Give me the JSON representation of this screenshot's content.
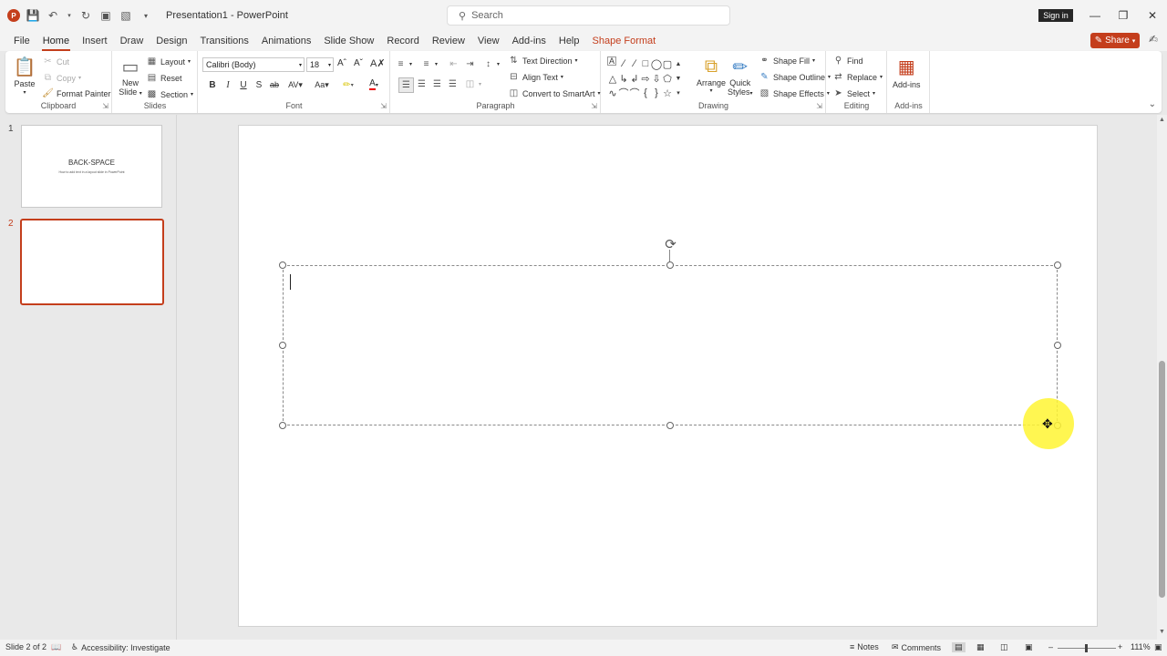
{
  "app": {
    "doc_title": "Presentation1",
    "app_name": "PowerPoint",
    "title_sep": " - ",
    "search_placeholder": "Search",
    "sign_in": "Sign in",
    "share": "Share"
  },
  "tabs": [
    {
      "label": "File"
    },
    {
      "label": "Home",
      "active": true
    },
    {
      "label": "Insert"
    },
    {
      "label": "Draw"
    },
    {
      "label": "Design"
    },
    {
      "label": "Transitions"
    },
    {
      "label": "Animations"
    },
    {
      "label": "Slide Show"
    },
    {
      "label": "Record"
    },
    {
      "label": "Review"
    },
    {
      "label": "View"
    },
    {
      "label": "Add-ins"
    },
    {
      "label": "Help"
    },
    {
      "label": "Shape Format",
      "contextual": true
    }
  ],
  "ribbon": {
    "clipboard": {
      "label": "Clipboard",
      "paste": "Paste",
      "cut": "Cut",
      "copy": "Copy",
      "format_painter": "Format Painter"
    },
    "slides": {
      "label": "Slides",
      "new_slide_1": "New",
      "new_slide_2": "Slide",
      "layout": "Layout",
      "reset": "Reset",
      "section": "Section"
    },
    "font": {
      "label": "Font",
      "font_name": "Calibri (Body)",
      "font_size": "18"
    },
    "paragraph": {
      "label": "Paragraph",
      "text_direction": "Text Direction",
      "align_text": "Align Text",
      "convert_smartart": "Convert to SmartArt"
    },
    "drawing": {
      "label": "Drawing",
      "arrange": "Arrange",
      "quick_styles_1": "Quick",
      "quick_styles_2": "Styles",
      "shape_fill": "Shape Fill",
      "shape_outline": "Shape Outline",
      "shape_effects": "Shape Effects"
    },
    "editing": {
      "label": "Editing",
      "find": "Find",
      "replace": "Replace",
      "select": "Select"
    },
    "addins": {
      "label": "Add-ins",
      "addins": "Add-ins"
    }
  },
  "thumbnails": [
    {
      "num": "1",
      "title": "BACK-SPACE",
      "subtitle": "How to add text in a layout slide in PowerPoint"
    },
    {
      "num": "2",
      "title": "",
      "subtitle": ""
    }
  ],
  "status": {
    "slide_info": "Slide 2 of 2",
    "accessibility": "Accessibility: Investigate",
    "notes": "Notes",
    "comments": "Comments",
    "zoom": "111%"
  }
}
